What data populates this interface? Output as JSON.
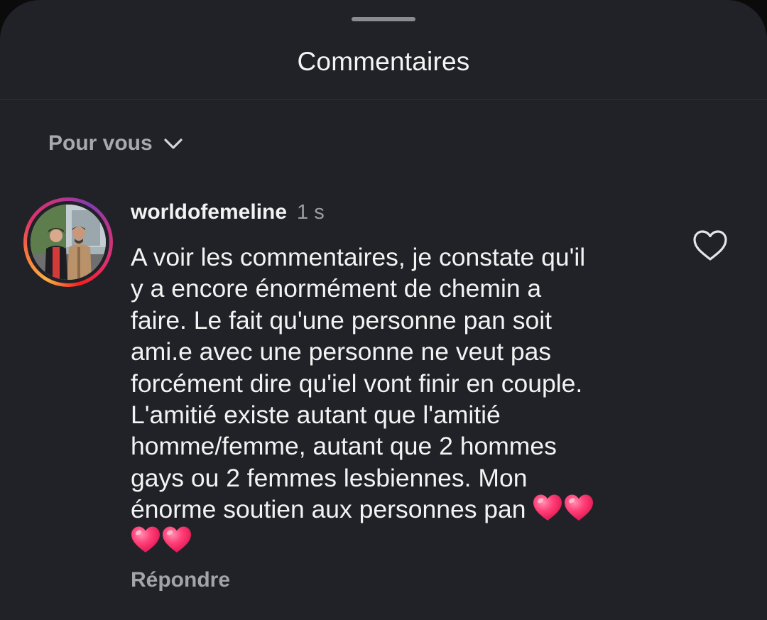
{
  "sheet": {
    "title": "Commentaires",
    "filter_label": "Pour vous"
  },
  "comment": {
    "username": "worldofemeline",
    "time": "1 s",
    "lines": [
      "A voir les commentaires, je constate qu'il",
      "y a encore énormément de chemin a",
      "faire. Le fait qu'une personne pan soit",
      "ami.e avec une personne ne veut pas",
      "forcément dire qu'iel vont finir en couple.",
      "L'amitié existe autant que l'amitié",
      "homme/femme, autant que 2 hommes",
      "gays ou 2 femmes lesbiennes. Mon",
      "énorme soutien aux personnes pan "
    ],
    "emoji": [
      "pink-heart",
      "pink-heart",
      "pink-heart",
      "pink-heart"
    ],
    "reply_label": "Répondre",
    "liked": false
  },
  "icons": {
    "filter": "chevron-down-icon",
    "like": "heart-outline-icon"
  },
  "colors": {
    "background": "#212227",
    "text": "#f3f3f3",
    "muted": "#a3a4a9",
    "heart_emoji": "#ff3a72"
  }
}
